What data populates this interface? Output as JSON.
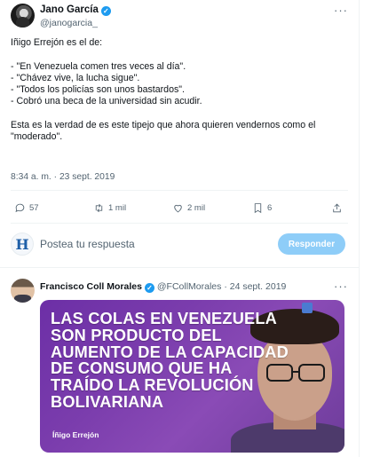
{
  "main_tweet": {
    "author_name": "Jano García",
    "handle": "@janogarcia_",
    "more_label": "···",
    "text_lines": [
      "Iñigo Errejón es el de:",
      "",
      "- \"En Venezuela comen tres veces al día\".",
      "- \"Chávez vive, la lucha sigue\".",
      "- \"Todos los policías son unos bastardos\".",
      "- Cobró una beca de la universidad sin acudir.",
      "",
      "Esta es la verdad de es este tipejo que ahora quieren vendernos como el",
      "\"moderado\"."
    ],
    "timestamp": "8:34 a. m. · 23 sept. 2019",
    "actions": {
      "replies": "57",
      "retweets": "1 mil",
      "likes": "2 mil",
      "bookmarks": "6"
    }
  },
  "reply_box": {
    "avatar_letter": "H",
    "placeholder": "Postea tu respuesta",
    "button_label": "Responder"
  },
  "second_tweet": {
    "author_name": "Francisco Coll Morales",
    "handle": "@FCollMorales",
    "date": "24 sept. 2019",
    "separator": "·",
    "more_label": "···",
    "image": {
      "headline_lines": [
        "LAS COLAS EN VENEZUELA",
        "SON PRODUCTO DEL",
        "AUMENTO DE LA CAPACIDAD",
        "DE CONSUMO QUE HA",
        "TRAÍDO LA REVOLUCIÓN",
        "BOLIVARIANA"
      ],
      "signature": "Íñigo Errejón"
    }
  },
  "colors": {
    "accent": "#1d9bf0",
    "reply_button": "#8ecdf8",
    "secondary_text": "#536471",
    "image_background": "#7b3dad"
  },
  "icons": [
    "reply-icon",
    "retweet-icon",
    "like-icon",
    "bookmark-icon",
    "share-icon",
    "verified-icon",
    "more-icon"
  ]
}
